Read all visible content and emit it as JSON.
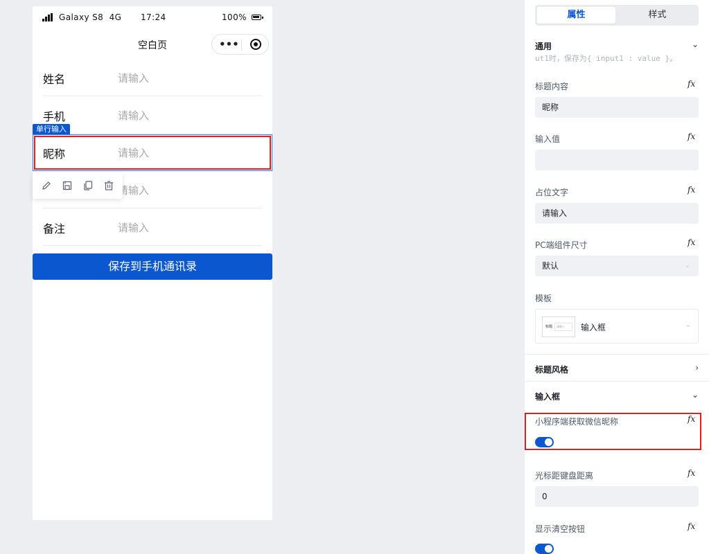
{
  "phone": {
    "status_bar": {
      "carrier": "Galaxy S8  4G",
      "time": "17:24",
      "battery": "100%"
    },
    "nav_title": "空白页",
    "capsule": {
      "more_glyph": "•••"
    },
    "form_rows": [
      {
        "label": "姓名",
        "placeholder": "请输入"
      },
      {
        "label": "手机",
        "placeholder": "请输入"
      },
      {
        "label": "昵称",
        "placeholder": "请输入"
      },
      {
        "label": "",
        "placeholder": "请输入"
      },
      {
        "label": "备注",
        "placeholder": "请输入"
      }
    ],
    "selection_tag": "单行输入",
    "save_button": "保存到手机通讯录"
  },
  "panel": {
    "tabs": [
      "属性",
      "样式"
    ],
    "active_tab": "属性",
    "section_general": "通用",
    "clipped_text": "ut1时，保存为{ input1 : value }。",
    "fx": "fx",
    "fields": {
      "title_content": {
        "label": "标题内容",
        "value": "昵称"
      },
      "input_value": {
        "label": "输入值",
        "value": ""
      },
      "placeholder_text": {
        "label": "占位文字",
        "value": "请输入"
      },
      "pc_size": {
        "label": "PC端组件尺寸",
        "value": "默认"
      },
      "template": {
        "label": "模板",
        "value": "输入框",
        "thumb_title": "标题",
        "thumb_input": "请输入"
      },
      "wechat_nickname": {
        "label": "小程序端获取微信昵称",
        "enabled": true
      },
      "cursor_spacing": {
        "label": "光标距键盘距离",
        "value": "0"
      },
      "show_clear": {
        "label": "显示清空按钮",
        "enabled": true
      }
    },
    "section_title_style": "标题风格",
    "section_input_box": "输入框"
  },
  "colors": {
    "primary": "#0b57d0",
    "highlight": "#e02020",
    "selection": "#3b7cf0"
  },
  "icons": [
    "signal-icon",
    "battery-icon",
    "more-icon",
    "target-icon",
    "edit-icon",
    "save-icon",
    "copy-icon",
    "delete-icon",
    "chevron-down-icon",
    "chevron-right-icon",
    "fx-icon"
  ]
}
